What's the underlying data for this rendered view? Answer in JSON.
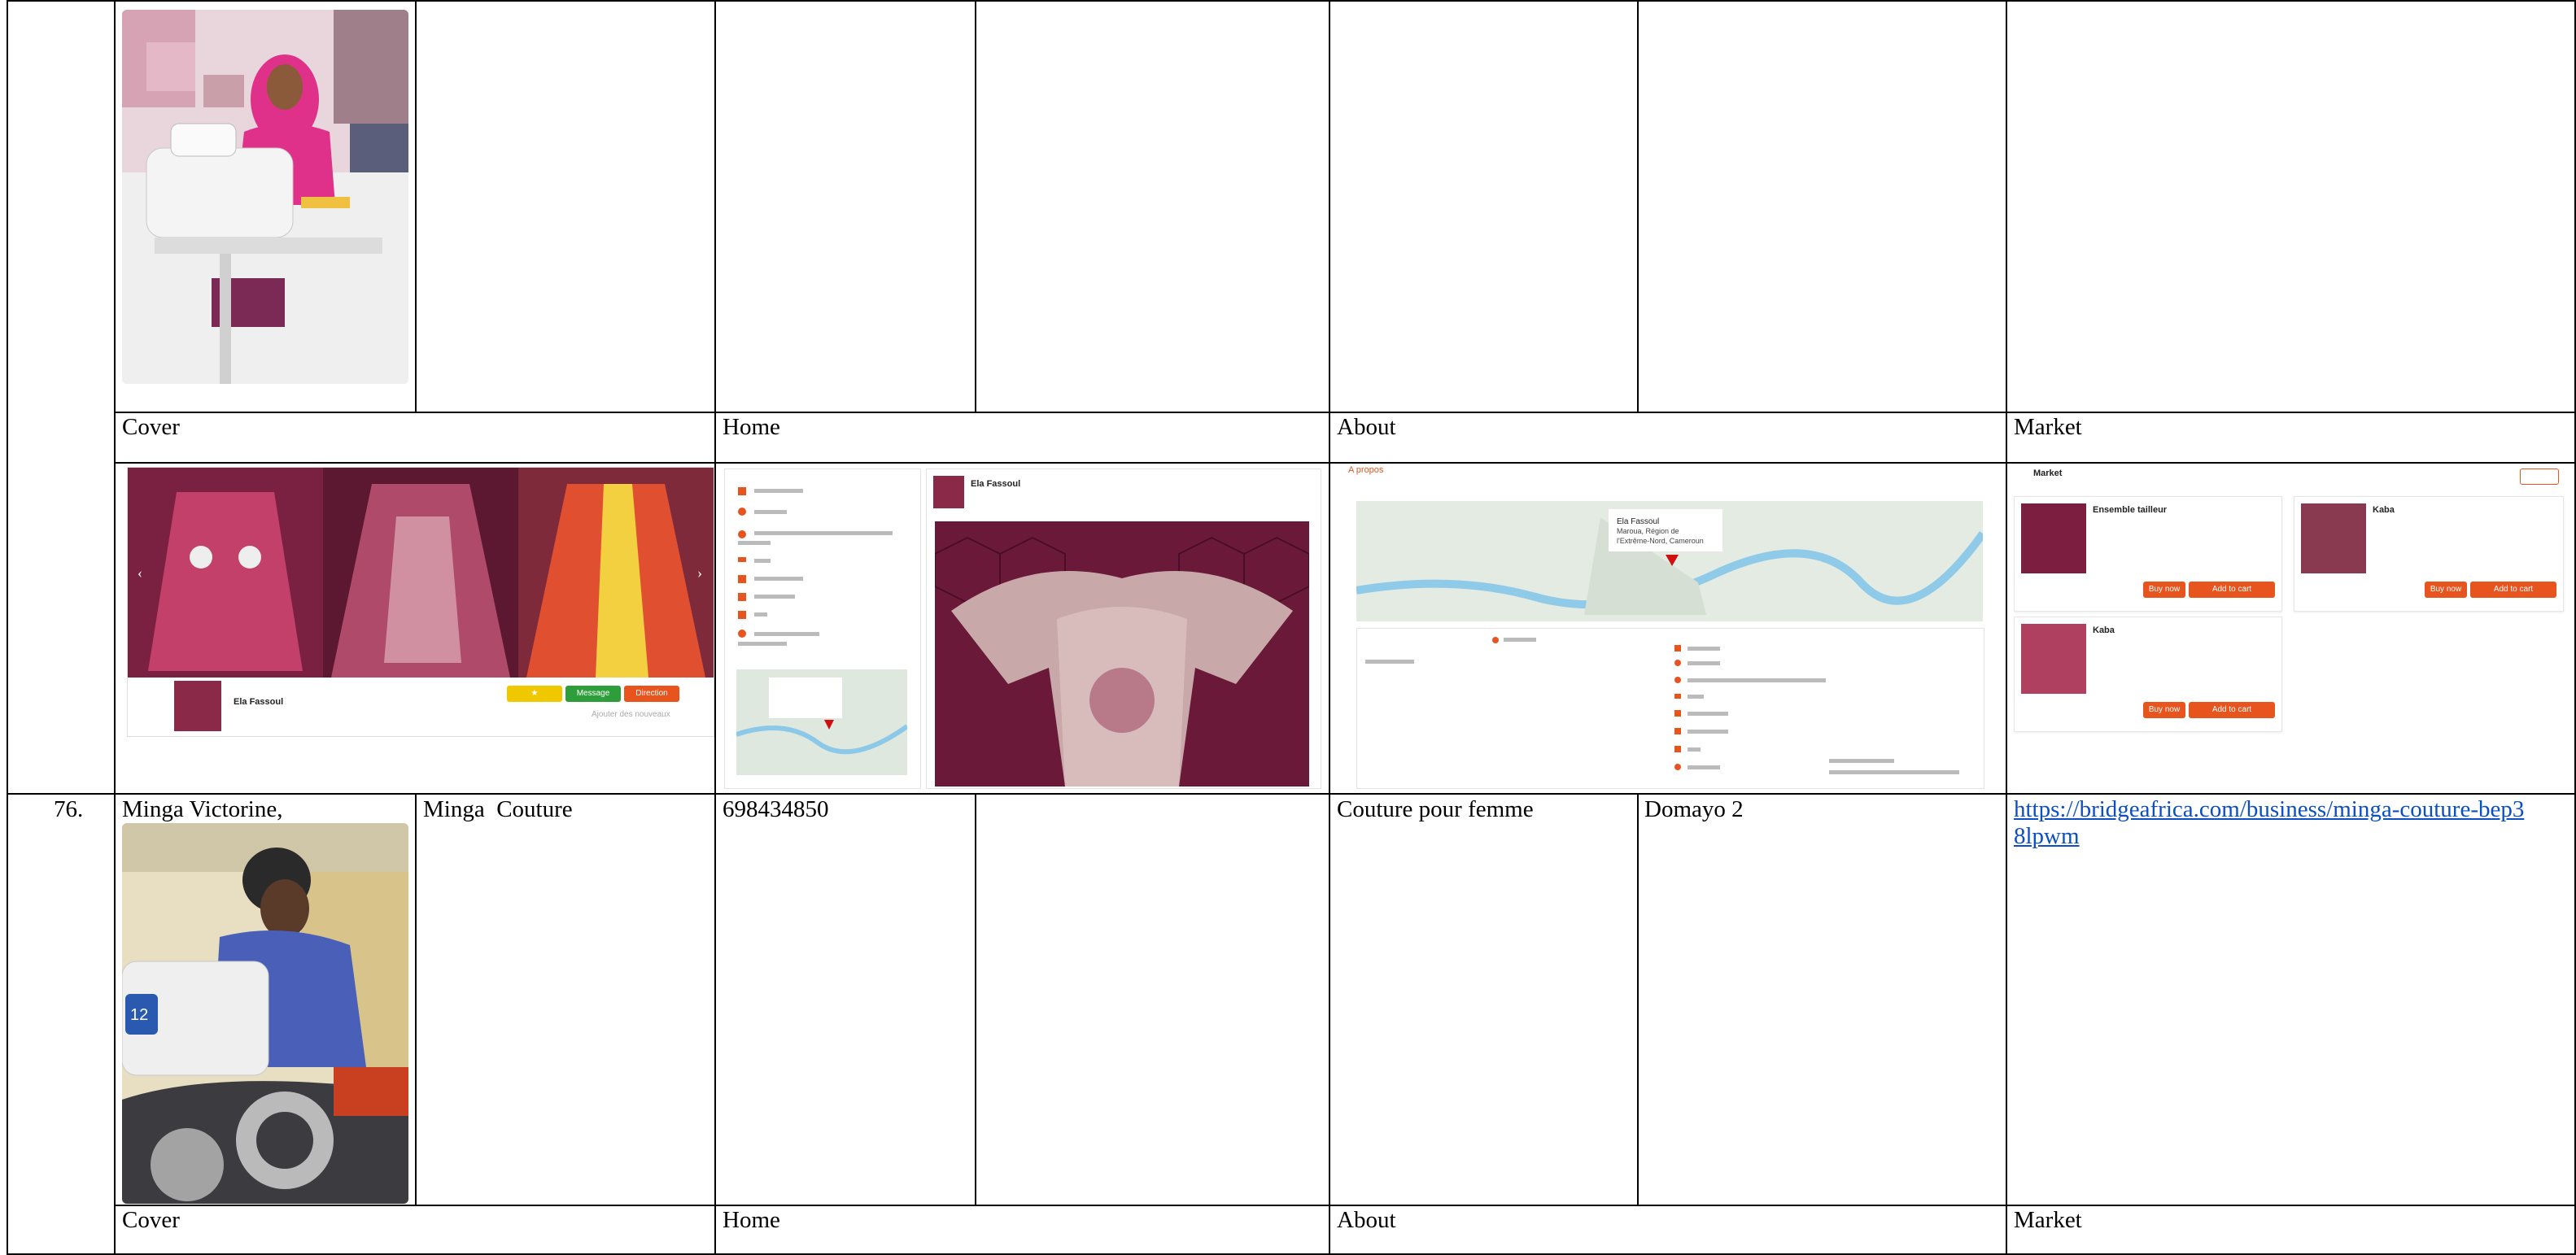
{
  "table": {
    "row_top": {
      "labels": {
        "cover": "Cover",
        "home": "Home",
        "about": "About",
        "market": "Market"
      },
      "screenshots": {
        "cover": {
          "business_name": "Ela Fassoul",
          "btn_message": "Message",
          "btn_direction": "Direction",
          "side_text": "Ajouter des nouveaux"
        },
        "home": {
          "post_author": "Ela Fassoul"
        },
        "about": {
          "title": "A propos",
          "map_label_1": "Ela Fassoul",
          "map_label_2": "Maroua, Région de",
          "map_label_3": "l'Extrême-Nord, Cameroun"
        },
        "market": {
          "title": "Market",
          "products": [
            {
              "name": "Ensemble tailleur"
            },
            {
              "name": "Kaba"
            },
            {
              "name": "Kaba"
            }
          ],
          "btn_buy": "Buy now",
          "btn_cart": "Add to cart"
        }
      }
    },
    "row_76": {
      "number": "76.",
      "owner": "Minga Victorine,",
      "business": "Minga  Couture",
      "phone": "698434850",
      "activity": "Couture pour femme",
      "location": "Domayo 2",
      "url": "https://bridgeafrica.com/business/minga-couture-bep38lpwm",
      "labels": {
        "cover": "Cover",
        "home": "Home",
        "about": "About",
        "market": "Market"
      }
    }
  }
}
